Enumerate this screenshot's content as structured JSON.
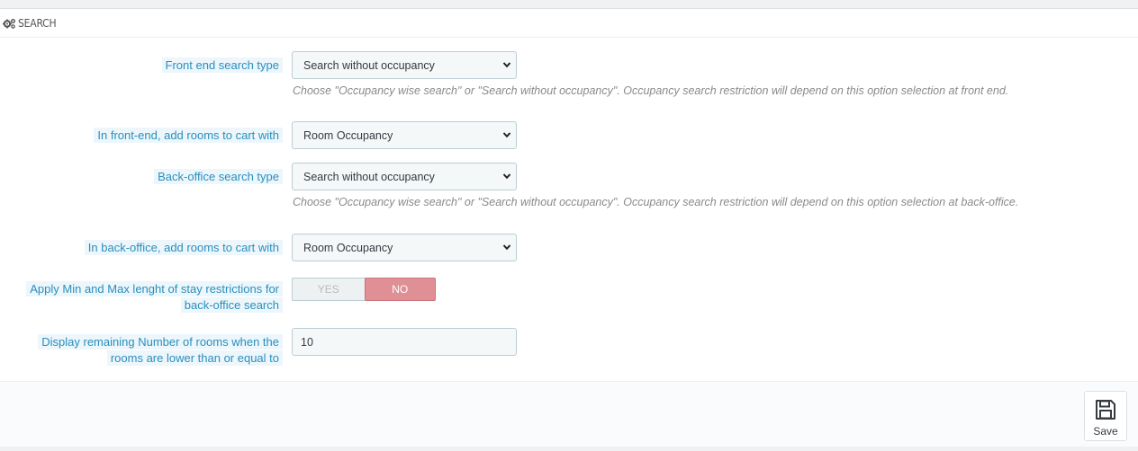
{
  "panel": {
    "title": "Search",
    "title_icon": "cogs-icon"
  },
  "fields": {
    "front_search_type": {
      "label": "Front end search type",
      "value": "Search without occupancy",
      "help": "Choose \"Occupancy wise search\" or \"Search without occupancy\". Occupancy search restriction will depend on this option selection at front end."
    },
    "front_add_rooms": {
      "label": "In front-end, add rooms to cart with",
      "value": "Room Occupancy"
    },
    "back_search_type": {
      "label": "Back-office search type",
      "value": "Search without occupancy",
      "help": "Choose \"Occupancy wise search\" or \"Search without occupancy\". Occupancy search restriction will depend on this option selection at back-office."
    },
    "back_add_rooms": {
      "label": "In back-office, add rooms to cart with",
      "value": "Room Occupancy"
    },
    "stay_restrictions": {
      "label_line1": "Apply Min and Max lenght of stay restrictions for",
      "label_line2": "back-office search",
      "yes_label": "YES",
      "no_label": "NO",
      "selected": "NO"
    },
    "remaining_rooms": {
      "label_line1": "Display remaining Number of rooms when the",
      "label_line2": "rooms are lower than or equal to",
      "value": "10"
    }
  },
  "footer": {
    "save_label": "Save",
    "save_icon": "floppy-disk-icon"
  }
}
